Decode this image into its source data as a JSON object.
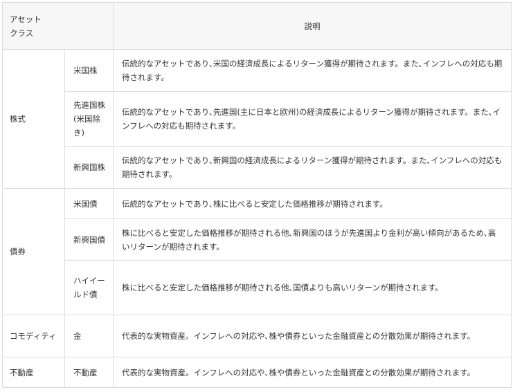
{
  "table": {
    "header": {
      "asset_class_line1": "アセット",
      "asset_class_line2": "クラス",
      "description": "説明"
    },
    "groups": {
      "stocks": "株式",
      "bonds": "債券",
      "commodity": "コモディティ",
      "real_estate": "不動産"
    },
    "rows": [
      {
        "sub": "米国株",
        "desc": "伝統的なアセットであり､米国の経済成長によるリターン獲得が期待されます。また､インフレへの対応も期待されます。"
      },
      {
        "sub": "先進国株(米国除き)",
        "desc": "伝統的なアセットであり､先進国(主に日本と欧州)の経済成長によるリターン獲得が期待されます。また､インフレへの対応も期待されます。"
      },
      {
        "sub": "新興国株",
        "desc": "伝統的なアセットであり､新興国の経済成長によるリターン獲得が期待されます。また､インフレへの対応も期待されます。"
      },
      {
        "sub": "米国債",
        "desc": "伝統的なアセットであり､株に比べると安定した価格推移が期待されます。"
      },
      {
        "sub": "新興国債",
        "desc": "株に比べると安定した価格推移が期待される他､新興国のほうが先進国より金利が高い傾向があるため､高いリターンが期待されます。"
      },
      {
        "sub": "ハイイールド債",
        "desc": "株に比べると安定した価格推移が期待される他､国債よりも高いリターンが期待されます。"
      },
      {
        "sub": "金",
        "desc": "代表的な実物資産。インフレへの対応や､株や債券といった金融資産との分散効果が期待されます。"
      },
      {
        "sub": "不動産",
        "desc": "代表的な実物資産。インフレへの対応や､株や債券といった金融資産との分散効果が期待されます。"
      }
    ]
  }
}
